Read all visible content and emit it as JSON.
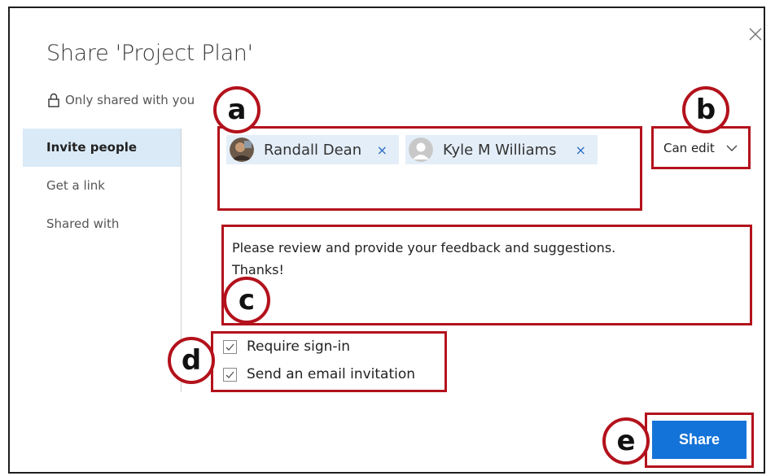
{
  "dialog": {
    "title": "Share 'Project Plan'",
    "access_status": "Only shared with you"
  },
  "nav": {
    "items": [
      {
        "label": "Invite people",
        "active": true
      },
      {
        "label": "Get a link",
        "active": false
      },
      {
        "label": "Shared with",
        "active": false
      }
    ]
  },
  "recipients": [
    {
      "name": "Randall Dean",
      "remove": "×",
      "avatar": "photo-avatar"
    },
    {
      "name": "Kyle M Williams",
      "remove": "×",
      "avatar": "default-person-avatar"
    }
  ],
  "permission": {
    "selected": "Can edit",
    "icon": "chevron-down-icon"
  },
  "message": {
    "text": "Please review and provide your feedback and suggestions.\nThanks!"
  },
  "options": [
    {
      "label": "Require sign-in",
      "checked": true
    },
    {
      "label": "Send an email invitation",
      "checked": true
    }
  ],
  "share_button": {
    "label": "Share"
  },
  "callouts": [
    "a",
    "b",
    "c",
    "d",
    "e"
  ],
  "colors": {
    "accent": "#1473d8",
    "callout": "#b3121c",
    "nav_active": "#daeaf7",
    "chip": "#e4eef8"
  }
}
